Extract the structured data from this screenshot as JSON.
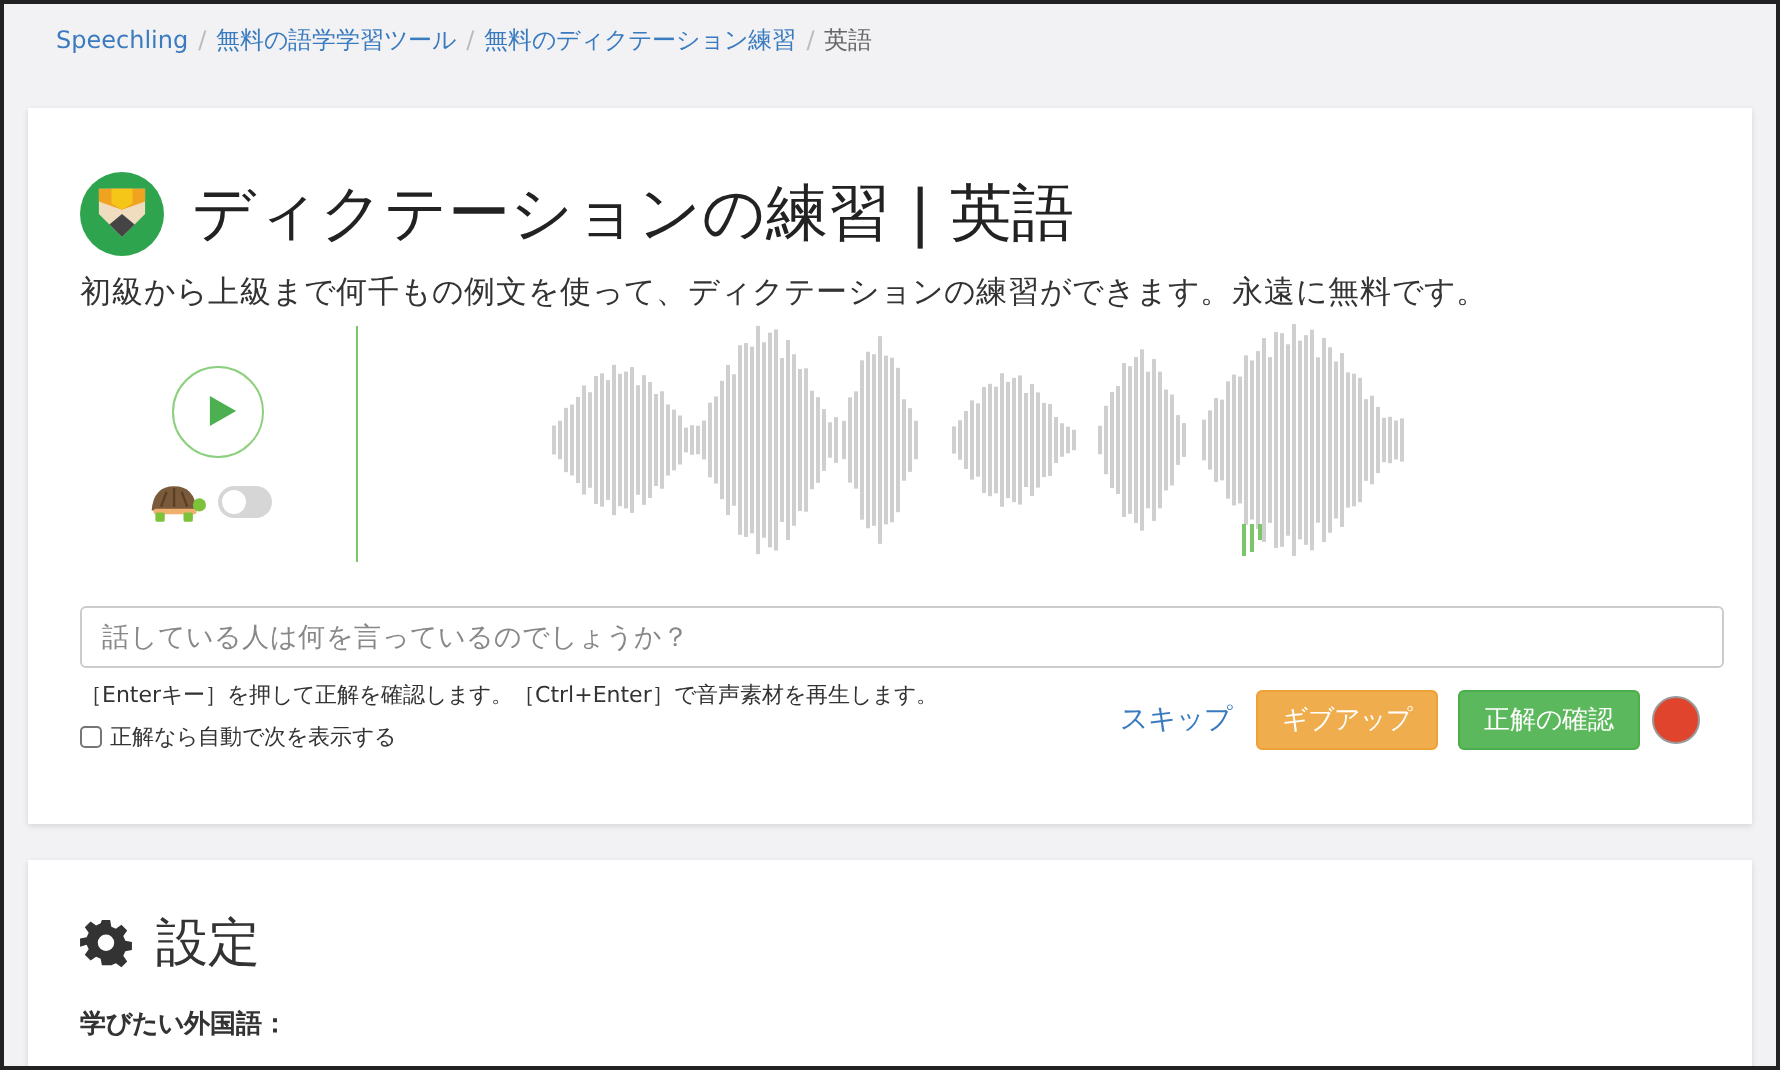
{
  "breadcrumb_separator": "/",
  "breadcrumb": [
    {
      "label": "Speechling",
      "link": true
    },
    {
      "label": "無料の語学学習ツール",
      "link": true
    },
    {
      "label": "無料のディクテーション練習",
      "link": true
    },
    {
      "label": "英語",
      "link": false
    }
  ],
  "title": "ディクテーションの練習 | 英語",
  "subtitle": "初級から上級まで何千もの例文を使って、ディクテーションの練習ができます。永遠に無料です。",
  "slow_mode": {
    "on": false
  },
  "answer": {
    "placeholder": "話している人は何を言っているのでしょうか？"
  },
  "hint": "［Enterキー］を押して正解を確認します。［Ctrl+Enter］で音声素材を再生します。",
  "auto_next": {
    "label": "正解なら自動で次を表示する",
    "checked": false
  },
  "skip": "スキップ",
  "buttons": [
    {
      "label": "ギブアップ",
      "kind": "warning"
    },
    {
      "label": "正解の確認",
      "kind": "success"
    }
  ],
  "settings": {
    "title": "設定",
    "next_label": "学びたい外国語："
  }
}
